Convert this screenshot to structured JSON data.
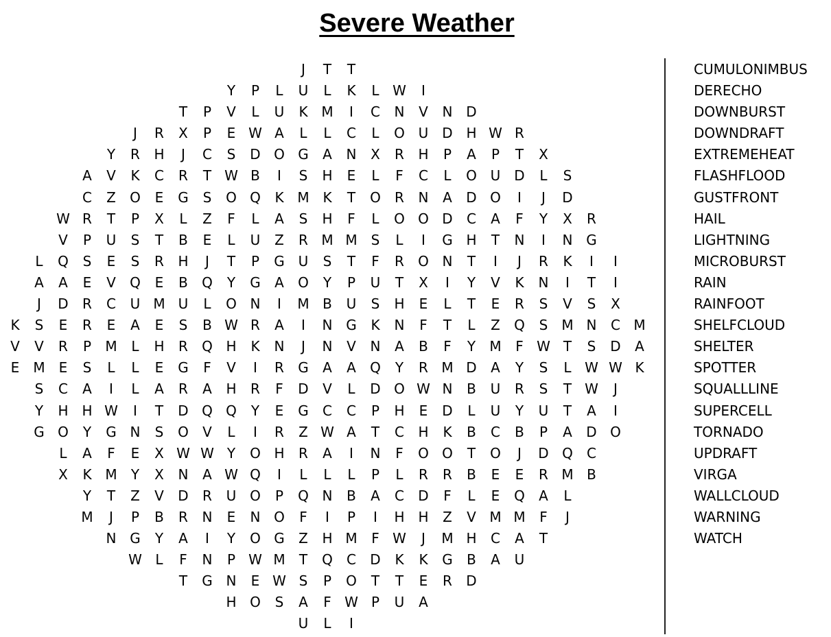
{
  "title": "Severe Weather",
  "grid_rows": [
    "JTT",
    "YPLULKLWI",
    "TPVLUKMICNVND",
    "JRXPEWALLCLOUDHWR",
    "YRHJCSDOGANXRHPAPTX",
    "AVKCRTWBISHELFCLOUDLS",
    "CZOEGSOQKMKTORNADOIJD",
    "WRTPXLZFLASHFLOODCAFYXR",
    "VPUSTBELUZRMMSLIGHTNING",
    "LQSESRHJTPGUSTFRONTIJRKII",
    "AAEVQEBQYGAOYPUTXIYVKNITI",
    "JDRCUMULONIMBUSHELTERSVSX",
    "KSEREAESBWRAINGKNFTLZQSMNCM",
    "VVRPMLHRQHKNJNVNABFYMFWTSDA",
    "EMESLLEGFVIRGAAQYRMDAYSLWWK",
    "SCAILARAHRFDVLDOWNBURSTWJ",
    "YHHWITDQQYEGCCPHEDLUYUTAI",
    "GOYGNSOVLIRZWATCHKBCBPADO",
    "LAFEXWWYOHRAINFOOTOJDQC",
    "XKMYXNAWQILLLPLRRBEERMB",
    "YTZVDRUOPQNBACDFLEQAL",
    "MJPBRNENOFIPIHHZVMMFJ",
    "NGYAIYOGZHMFWJMHCAT",
    "WLFNPWMTQCDKKGBAU",
    "TGNEWSPOTTERD",
    "HOSAFWPUA",
    "ULI"
  ],
  "word_list": [
    "CUMULONIMBUS",
    "DERECHO",
    "DOWNBURST",
    "DOWNDRAFT",
    "EXTREMEHEAT",
    "FLASHFLOOD",
    "GUSTFRONT",
    "HAIL",
    "LIGHTNING",
    "MICROBURST",
    "RAIN",
    "RAINFOOT",
    "SHELFCLOUD",
    "SHELTER",
    "SPOTTER",
    "SQUALLLINE",
    "SUPERCELL",
    "TORNADO",
    "UPDRAFT",
    "VIRGA",
    "WALLCLOUD",
    "WARNING",
    "WATCH"
  ]
}
